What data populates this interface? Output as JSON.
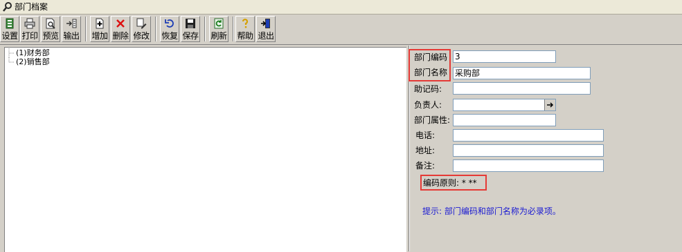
{
  "window": {
    "title": "部门档案",
    "icon": "magnifier-icon"
  },
  "toolbar": {
    "buttons": [
      {
        "label": "设置",
        "icon": "settings-icon"
      },
      {
        "label": "打印",
        "icon": "printer-icon"
      },
      {
        "label": "预览",
        "icon": "preview-icon"
      },
      {
        "label": "输出",
        "icon": "export-icon"
      },
      {
        "label": "增加",
        "icon": "add-icon"
      },
      {
        "label": "删除",
        "icon": "delete-icon"
      },
      {
        "label": "修改",
        "icon": "edit-icon"
      },
      {
        "label": "恢复",
        "icon": "undo-icon"
      },
      {
        "label": "保存",
        "icon": "save-icon"
      },
      {
        "label": "刷新",
        "icon": "refresh-icon"
      },
      {
        "label": "帮助",
        "icon": "help-icon"
      },
      {
        "label": "退出",
        "icon": "exit-icon"
      }
    ]
  },
  "tree": {
    "items": [
      {
        "label": "(1)财务部"
      },
      {
        "label": "(2)销售部"
      }
    ]
  },
  "form": {
    "dept_code": {
      "label": "部门编码",
      "value": "3"
    },
    "dept_name": {
      "label": "部门名称",
      "value": "采购部"
    },
    "mnemonic": {
      "label": "助记码:",
      "value": ""
    },
    "manager": {
      "label": "负责人:",
      "value": ""
    },
    "attribute": {
      "label": "部门属性:",
      "value": ""
    },
    "phone": {
      "label": "电话:",
      "value": ""
    },
    "address": {
      "label": "地址:",
      "value": ""
    },
    "remark": {
      "label": "备注:",
      "value": ""
    },
    "code_rule": "编码原则: * **",
    "hint": "提示: 部门编码和部门名称为必录项。"
  },
  "colors": {
    "highlight": "#e53935",
    "hint": "#1a1ad2"
  }
}
